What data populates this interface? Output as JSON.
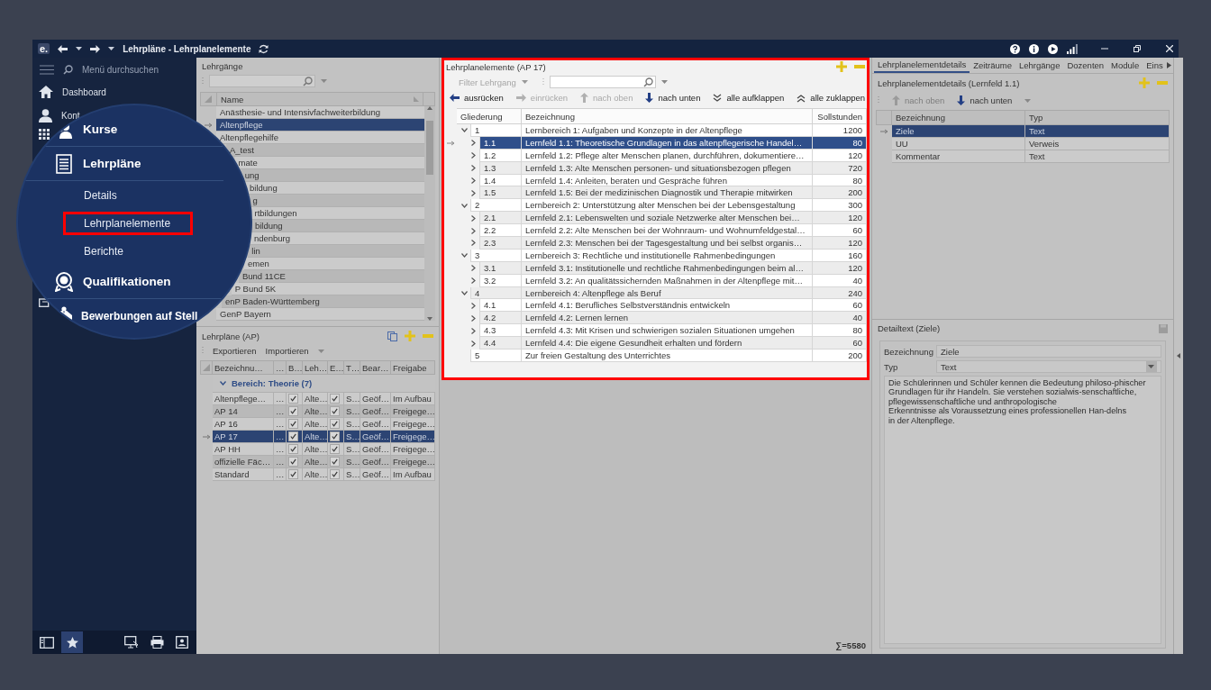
{
  "window": {
    "logo": "e.",
    "title": "Lehrpläne - Lehrplanelemente"
  },
  "sidebar": {
    "search_placeholder": "Menü durchsuchen",
    "items": [
      {
        "label": "Dashboard"
      },
      {
        "label": "Kont"
      }
    ],
    "bottom_buttons": [
      {
        "selected": false
      },
      {
        "selected": true
      },
      {
        "selected": false
      },
      {
        "selected": false
      },
      {
        "selected": false
      }
    ]
  },
  "magnifier": {
    "items": [
      {
        "kind": "section",
        "label": "Kurse"
      },
      {
        "kind": "section",
        "label": "Lehrpläne"
      },
      {
        "kind": "sub",
        "label": "Details",
        "selected": false
      },
      {
        "kind": "sub",
        "label": "Lehrplanelemente",
        "selected": true
      },
      {
        "kind": "sub",
        "label": "Berichte",
        "selected": false
      },
      {
        "kind": "section",
        "label": "Qualifikationen"
      },
      {
        "kind": "section",
        "label": "Bewerbungen auf Stell"
      }
    ]
  },
  "courses": {
    "title": "Lehrgänge",
    "column": "Name",
    "rows": [
      {
        "name": "Anästhesie- und Intensivfachweiterbildung",
        "selected": false
      },
      {
        "name": "Altenpflege",
        "selected": true
      },
      {
        "name": "Altenpflegehilfe",
        "selected": false
      },
      {
        "name": "A_test",
        "selected": false
      },
      {
        "name": "mate",
        "selected": false
      },
      {
        "name": "ung",
        "selected": false
      },
      {
        "name": "bildung",
        "selected": false
      },
      {
        "name": "g",
        "selected": false
      },
      {
        "name": "rtbildungen",
        "selected": false
      },
      {
        "name": "bildung",
        "selected": false
      },
      {
        "name": "ndenburg",
        "selected": false
      },
      {
        "name": "lin",
        "selected": false
      },
      {
        "name": "emen",
        "selected": false
      },
      {
        "name": "Bund 11CE",
        "selected": false
      },
      {
        "name": "P Bund 5K",
        "selected": false
      },
      {
        "name": "enP Baden-Württemberg",
        "selected": false
      },
      {
        "name": "GenP Bayern",
        "selected": false
      }
    ]
  },
  "curricula": {
    "title": "Lehrpläne (AP)",
    "toolbar": [
      "Exportieren",
      "Importieren"
    ],
    "columns": [
      "Bezeichnu…",
      "…",
      "B…",
      "Leh…",
      "E…",
      "T…",
      "Bear…",
      "Freigabe"
    ],
    "group": {
      "label": "Bereich: Theorie (7)",
      "expanded": true
    },
    "rows": [
      {
        "name": "Altenpflege…",
        "column_2": "…",
        "column_3_checked": true,
        "column_4": "Alte…",
        "column_5_checked": true,
        "column_6": "S…",
        "column_7": "Geöf…",
        "freigabe": "Im Aufbau",
        "selected": false
      },
      {
        "name": "AP 14",
        "column_2": "…",
        "column_3_checked": true,
        "column_4": "Alte…",
        "column_5_checked": true,
        "column_6": "S…",
        "column_7": "Geöf…",
        "freigabe": "Freigege…",
        "selected": false
      },
      {
        "name": "AP 16",
        "column_2": "…",
        "column_3_checked": true,
        "column_4": "Alte…",
        "column_5_checked": true,
        "column_6": "S…",
        "column_7": "Geöf…",
        "freigabe": "Freigege…",
        "selected": false
      },
      {
        "name": "AP 17",
        "column_2": "…",
        "column_3_checked": true,
        "column_4": "Alte…",
        "column_5_checked": true,
        "column_6": "S…",
        "column_7": "Geöf…",
        "freigabe": "Freigege…",
        "selected": true
      },
      {
        "name": "AP HH",
        "column_2": "…",
        "column_3_checked": true,
        "column_4": "Alte…",
        "column_5_checked": true,
        "column_6": "S…",
        "column_7": "Geöf…",
        "freigabe": "Freigege…",
        "selected": false
      },
      {
        "name": "offizielle Fäc…",
        "column_2": "…",
        "column_3_checked": true,
        "column_4": "Alte…",
        "column_5_checked": true,
        "column_6": "S…",
        "column_7": "Geöf…",
        "freigabe": "Freigege…",
        "selected": false
      },
      {
        "name": "Standard",
        "column_2": "…",
        "column_3_checked": true,
        "column_4": "Alte…",
        "column_5_checked": true,
        "column_6": "S…",
        "column_7": "Geöf…",
        "freigabe": "Im Aufbau",
        "selected": false
      }
    ]
  },
  "elements": {
    "title": "Lehrplanelemente (AP 17)",
    "filter": {
      "placeholder": "Filter Lehrgang",
      "disabled": true
    },
    "toolbar": [
      {
        "label": "ausrücken",
        "disabled": false
      },
      {
        "label": "einrücken",
        "disabled": true
      },
      {
        "label": "nach oben",
        "disabled": true
      },
      {
        "label": "nach unten",
        "disabled": false
      },
      {
        "label": "alle aufklappen",
        "disabled": false
      },
      {
        "label": "alle zuklappen",
        "disabled": false
      }
    ],
    "columns": [
      "Gliederung",
      "Bezeichnung",
      "Sollstunden"
    ],
    "tree": [
      {
        "number": "1",
        "title": "Lernbereich 1: Aufgaben und Konzepte in der Altenpflege",
        "hours": "1200",
        "expanded": true,
        "selected": false,
        "children": [
          {
            "number": "1.1",
            "title": "Lernfeld 1.1: Theoretische Grundlagen in das altenpflegerische Handel…",
            "hours": "80",
            "expanded": false,
            "selected": true
          },
          {
            "number": "1.2",
            "title": "Lernfeld 1.2: Pflege alter Menschen planen, durchführen, dokumentiere…",
            "hours": "120",
            "expanded": false,
            "selected": false
          },
          {
            "number": "1.3",
            "title": "Lernfeld 1.3: Alte Menschen personen- und situationsbezogen pflegen",
            "hours": "720",
            "expanded": false,
            "selected": false
          },
          {
            "number": "1.4",
            "title": "Lernfeld 1.4: Anleiten, beraten und Gespräche führen",
            "hours": "80",
            "expanded": false,
            "selected": false
          },
          {
            "number": "1.5",
            "title": "Lernfeld 1.5: Bei der medizinischen Diagnostik und Therapie mitwirken",
            "hours": "200",
            "expanded": false,
            "selected": false
          }
        ]
      },
      {
        "number": "2",
        "title": "Lernbereich 2: Unterstützung alter Menschen bei der Lebensgestaltung",
        "hours": "300",
        "expanded": true,
        "selected": false,
        "children": [
          {
            "number": "2.1",
            "title": "Lernfeld 2.1: Lebenswelten und soziale Netzwerke alter Menschen bei…",
            "hours": "120",
            "expanded": false,
            "selected": false
          },
          {
            "number": "2.2",
            "title": "Lernfeld 2.2: Alte Menschen bei der Wohnraum- und Wohnumfeldgestal…",
            "hours": "60",
            "expanded": false,
            "selected": false
          },
          {
            "number": "2.3",
            "title": "Lernfeld 2.3:  Menschen bei der Tagesgestaltung und bei selbst organis…",
            "hours": "120",
            "expanded": false,
            "selected": false
          }
        ]
      },
      {
        "number": "3",
        "title": "Lernbereich 3: Rechtliche und institutionelle Rahmenbedingungen",
        "hours": "160",
        "expanded": true,
        "selected": false,
        "children": [
          {
            "number": "3.1",
            "title": "Lernfeld 3.1: Institutionelle und rechtliche Rahmenbedingungen beim al…",
            "hours": "120",
            "expanded": false,
            "selected": false
          },
          {
            "number": "3.2",
            "title": "Lernfeld 3.2: An qualitätssichernden Maßnahmen in der Altenpflege mit…",
            "hours": "40",
            "expanded": false,
            "selected": false
          }
        ]
      },
      {
        "number": "4",
        "title": "Lernbereich 4: Altenpflege als Beruf",
        "hours": "240",
        "expanded": true,
        "selected": false,
        "children": [
          {
            "number": "4.1",
            "title": "Lernfeld 4.1: Berufliches Selbstverständnis entwickeln",
            "hours": "60",
            "expanded": false,
            "selected": false
          },
          {
            "number": "4.2",
            "title": "Lernfeld 4.2: Lernen lernen",
            "hours": "40",
            "expanded": false,
            "selected": false
          },
          {
            "number": "4.3",
            "title": "Lernfeld 4.3: Mit Krisen und schwierigen sozialen Situationen umgehen",
            "hours": "80",
            "expanded": false,
            "selected": false
          },
          {
            "number": "4.4",
            "title": "Lernfeld 4.4: Die eigene Gesundheit erhalten und fördern",
            "hours": "60",
            "expanded": false,
            "selected": false
          }
        ]
      },
      {
        "number": "5",
        "title": "Zur freien Gestaltung des Unterrichtes",
        "hours": "200",
        "selected": false
      }
    ],
    "total": "∑=5580"
  },
  "details": {
    "tabs": [
      {
        "label": "Lehrplanelementdetails",
        "selected": true
      },
      {
        "label": "Zeiträume",
        "selected": false
      },
      {
        "label": "Lehrgänge",
        "selected": false
      },
      {
        "label": "Dozenten",
        "selected": false
      },
      {
        "label": "Module",
        "selected": false
      },
      {
        "label": "Eins",
        "selected": false
      }
    ],
    "title": "Lehrplanelementdetails (Lernfeld 1.1)",
    "toolbar": [
      {
        "label": "nach oben",
        "disabled": true
      },
      {
        "label": "nach unten",
        "disabled": false
      }
    ],
    "columns": [
      "Bezeichnung",
      "Typ"
    ],
    "rows": [
      {
        "name": "Ziele",
        "type": "Text",
        "selected": true
      },
      {
        "name": "UU",
        "type": "Verweis",
        "selected": false
      },
      {
        "name": "Kommentar",
        "type": "Text",
        "selected": false
      }
    ]
  },
  "detail_text": {
    "title": "Detailtext (Ziele)",
    "fields": [
      {
        "label": "Bezeichnung",
        "value": "Ziele",
        "kind": "text"
      },
      {
        "label": "Typ",
        "value": "Text",
        "kind": "dropdown"
      }
    ],
    "text": "Die Schülerinnen und Schüler kennen die Bedeutung philoso-phischer\nGrundlagen für ihr Handeln. Sie verstehen sozialwis-senschaftliche,\npflegewissenschaftliche und anthropologische\nErkenntnisse als Voraussetzung eines professionellen Han-delns\nin der Altenpflege."
  }
}
